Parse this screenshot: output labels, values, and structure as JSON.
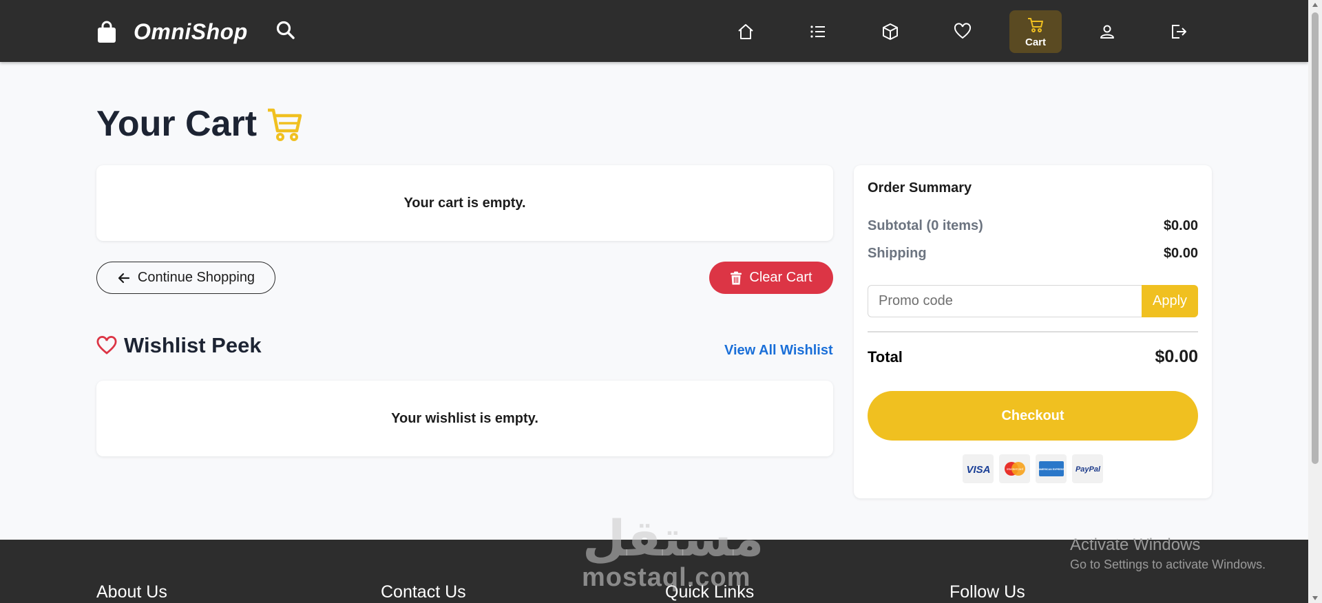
{
  "navbar": {
    "brand": "OmniShop",
    "items": [
      {
        "icon": "home-icon",
        "label": ""
      },
      {
        "icon": "list-icon",
        "label": ""
      },
      {
        "icon": "box-icon",
        "label": ""
      },
      {
        "icon": "heart-icon",
        "label": ""
      },
      {
        "icon": "cart-icon",
        "label": "Cart",
        "active": true
      },
      {
        "icon": "user-icon",
        "label": ""
      },
      {
        "icon": "logout-icon",
        "label": ""
      }
    ]
  },
  "main": {
    "title": "Your Cart",
    "cart_empty_text": "Your cart is empty.",
    "continue_label": "Continue Shopping",
    "clear_label": "Clear Cart",
    "wishlist": {
      "heading": "Wishlist Peek",
      "view_all": "View All Wishlist",
      "empty_text": "Your wishlist is empty."
    }
  },
  "summary": {
    "title": "Order Summary",
    "subtotal_label": "Subtotal (0 items)",
    "subtotal_value": "$0.00",
    "shipping_label": "Shipping",
    "shipping_value": "$0.00",
    "promo_placeholder": "Promo code",
    "apply_label": "Apply",
    "total_label": "Total",
    "total_value": "$0.00",
    "checkout_label": "Checkout",
    "payment_methods": [
      "VISA",
      "MasterCard",
      "AMERICAN EXPRESS",
      "PayPal"
    ]
  },
  "footer": {
    "headings": [
      "About Us",
      "Contact Us",
      "Quick Links",
      "Follow Us"
    ]
  },
  "overlay": {
    "watermark_ar": "مستقل",
    "watermark_en": "mostaql.com",
    "activate_title": "Activate Windows",
    "activate_sub": "Go to Settings to activate Windows."
  },
  "colors": {
    "nav_bg": "#2d2d2d",
    "accent": "#f0c020",
    "danger": "#dc3545",
    "link": "#1a6fd8",
    "page_bg": "#f8f9fb"
  }
}
